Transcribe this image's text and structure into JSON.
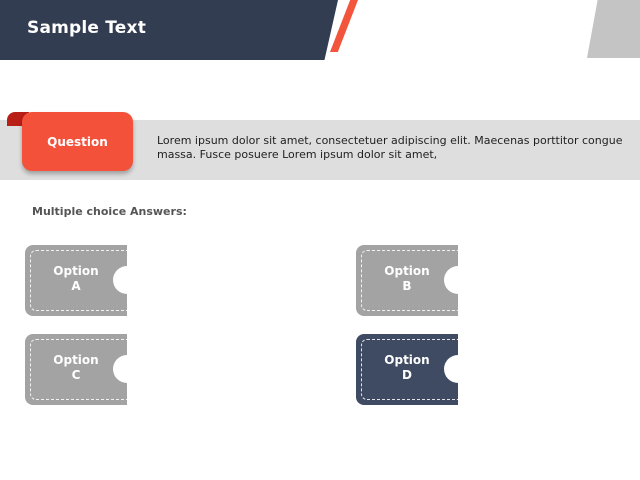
{
  "header": {
    "title": "Sample Text"
  },
  "question": {
    "tag": "Question",
    "text": "Lorem ipsum dolor sit amet, consectetuer adipiscing elit. Maecenas porttitor congue massa. Fusce posuere Lorem ipsum dolor sit amet,"
  },
  "answers": {
    "title": "Multiple choice Answers:",
    "options": [
      {
        "word": "Option",
        "letter": "A"
      },
      {
        "word": "Option",
        "letter": "B"
      },
      {
        "word": "Option",
        "letter": "C"
      },
      {
        "word": "Option",
        "letter": "D"
      }
    ]
  },
  "colors": {
    "header": "#333d51",
    "accent": "#f2553c",
    "option_default": "#a3a3a3",
    "option_selected": "#3f4b63"
  }
}
